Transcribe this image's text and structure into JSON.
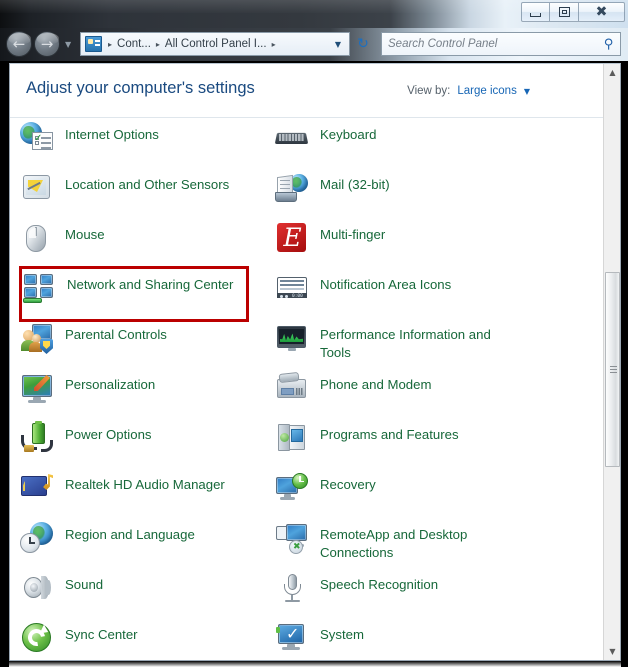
{
  "window": {
    "controls": {
      "minimize": "Minimize",
      "maximize": "Restore Down",
      "close": "Close"
    }
  },
  "navigation": {
    "back": "←",
    "forward": "→",
    "recent_pages_caret": "▼",
    "refresh": "↻",
    "breadcrumb": {
      "icon": "control-panel-icon",
      "items": [
        "Cont...",
        "All Control Panel I..."
      ],
      "separator": "▸",
      "trailing_separator": "▸",
      "dropdown_caret": "▼"
    }
  },
  "search": {
    "placeholder": "Search Control Panel",
    "value": "",
    "icon": "search-icon"
  },
  "header": {
    "title": "Adjust your computer's settings",
    "view_by_label": "View by:",
    "view_by_value": "Large icons",
    "view_by_caret": "▼"
  },
  "highlight": {
    "color": "#bb0000",
    "target": "Network and Sharing Center"
  },
  "colors": {
    "item_text": "#17683a",
    "title_text": "#1a4a80",
    "link_blue": "#1766b5",
    "highlight_red": "#bb0000"
  },
  "items": {
    "left_column": [
      {
        "label": "Internet Options",
        "icon": "internet-options-icon",
        "highlighted": false
      },
      {
        "label": "Location and Other Sensors",
        "icon": "location-sensors-icon",
        "highlighted": false
      },
      {
        "label": "Mouse",
        "icon": "mouse-icon",
        "highlighted": false
      },
      {
        "label": "Network and Sharing Center",
        "icon": "network-sharing-icon",
        "highlighted": true
      },
      {
        "label": "Parental Controls",
        "icon": "parental-controls-icon",
        "highlighted": false
      },
      {
        "label": "Personalization",
        "icon": "personalization-icon",
        "highlighted": false
      },
      {
        "label": "Power Options",
        "icon": "power-options-icon",
        "highlighted": false
      },
      {
        "label": "Realtek HD Audio Manager",
        "icon": "realtek-audio-icon",
        "highlighted": false
      },
      {
        "label": "Region and Language",
        "icon": "region-language-icon",
        "highlighted": false
      },
      {
        "label": "Sound",
        "icon": "sound-icon",
        "highlighted": false
      },
      {
        "label": "Sync Center",
        "icon": "sync-center-icon",
        "highlighted": false
      }
    ],
    "right_column": [
      {
        "label": "Keyboard",
        "icon": "keyboard-icon",
        "highlighted": false
      },
      {
        "label": "Mail (32-bit)",
        "icon": "mail-icon",
        "highlighted": false
      },
      {
        "label": "Multi-finger",
        "icon": "multi-finger-icon",
        "highlighted": false
      },
      {
        "label": "Notification Area Icons",
        "icon": "notification-area-icon",
        "highlighted": false
      },
      {
        "label": "Performance Information and Tools",
        "icon": "performance-info-icon",
        "highlighted": false
      },
      {
        "label": "Phone and Modem",
        "icon": "phone-modem-icon",
        "highlighted": false
      },
      {
        "label": "Programs and Features",
        "icon": "programs-features-icon",
        "highlighted": false
      },
      {
        "label": "Recovery",
        "icon": "recovery-icon",
        "highlighted": false
      },
      {
        "label": "RemoteApp and Desktop Connections",
        "icon": "remoteapp-desktop-icon",
        "highlighted": false
      },
      {
        "label": "Speech Recognition",
        "icon": "speech-recognition-icon",
        "highlighted": false
      },
      {
        "label": "System",
        "icon": "system-icon",
        "highlighted": false
      }
    ]
  },
  "scrollbar": {
    "up_arrow": "▲",
    "down_arrow": "▼"
  }
}
